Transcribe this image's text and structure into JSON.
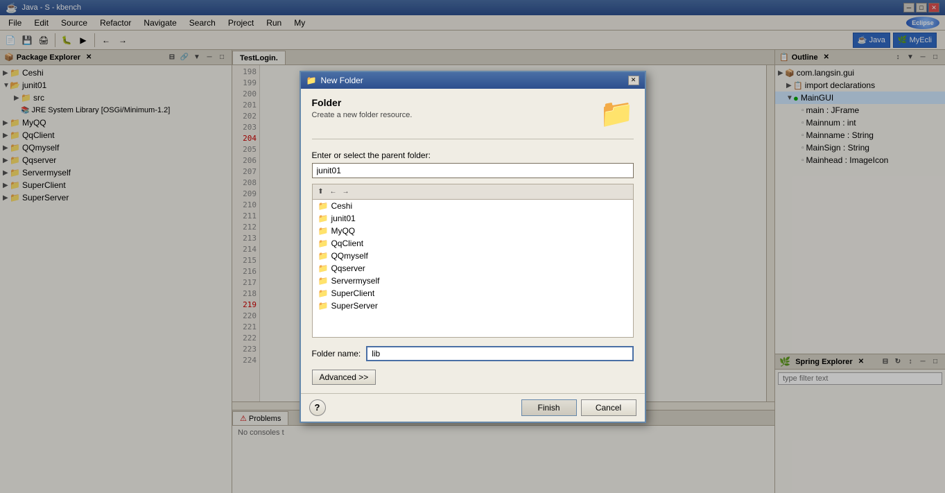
{
  "window": {
    "title": "Java - S",
    "title_full": "Java - S - kbench"
  },
  "dialog": {
    "title": "New Folder",
    "section_title": "Folder",
    "section_desc": "Create a new folder resource.",
    "parent_label": "Enter or select the parent folder:",
    "parent_value": "junit01",
    "folder_name_label": "Folder name:",
    "folder_name_value": "lib",
    "advanced_label": "Advanced >>",
    "finish_label": "Finish",
    "cancel_label": "Cancel",
    "help_label": "?",
    "tree_items": [
      {
        "label": "Ceshi",
        "icon": "📁"
      },
      {
        "label": "junit01",
        "icon": "📁"
      },
      {
        "label": "MyQQ",
        "icon": "📁"
      },
      {
        "label": "QqClient",
        "icon": "📁"
      },
      {
        "label": "QQmyself",
        "icon": "📁"
      },
      {
        "label": "Qqserver",
        "icon": "📁"
      },
      {
        "label": "Servermyself",
        "icon": "📁"
      },
      {
        "label": "SuperClient",
        "icon": "📁"
      },
      {
        "label": "SuperServer",
        "icon": "📁"
      }
    ]
  },
  "package_explorer": {
    "title": "Package Explorer",
    "items": [
      {
        "label": "Ceshi",
        "level": 0,
        "icon": "📁",
        "expanded": false
      },
      {
        "label": "junit01",
        "level": 0,
        "icon": "📂",
        "expanded": true
      },
      {
        "label": "src",
        "level": 1,
        "icon": "📁",
        "expanded": false
      },
      {
        "label": "JRE System Library [OSGi/Minimum-1.2]",
        "level": 1,
        "icon": "📚",
        "expanded": false
      },
      {
        "label": "MyQQ",
        "level": 0,
        "icon": "📁",
        "expanded": false
      },
      {
        "label": "QqClient",
        "level": 0,
        "icon": "📁",
        "expanded": false
      },
      {
        "label": "QQmyself",
        "level": 0,
        "icon": "📁",
        "expanded": false
      },
      {
        "label": "Qqserver",
        "level": 0,
        "icon": "📁",
        "expanded": false
      },
      {
        "label": "Servermyself",
        "level": 0,
        "icon": "📁",
        "expanded": false
      },
      {
        "label": "SuperClient",
        "level": 0,
        "icon": "📁",
        "expanded": false
      },
      {
        "label": "SuperServer",
        "level": 0,
        "icon": "📁",
        "expanded": false
      }
    ]
  },
  "editor": {
    "tab_label": "TestLogin.",
    "lines": [
      {
        "num": "198",
        "code": ""
      },
      {
        "num": "199",
        "code": ""
      },
      {
        "num": "200",
        "code": ""
      },
      {
        "num": "201",
        "code": ""
      },
      {
        "num": "202",
        "code": ""
      },
      {
        "num": "203",
        "code": ""
      },
      {
        "num": "204",
        "code": "",
        "marker": true
      },
      {
        "num": "205",
        "code": ""
      },
      {
        "num": "206",
        "code": ""
      },
      {
        "num": "207",
        "code": ""
      },
      {
        "num": "208",
        "code": ""
      },
      {
        "num": "209",
        "code": ""
      },
      {
        "num": "210",
        "code": ""
      },
      {
        "num": "211",
        "code": ""
      },
      {
        "num": "212",
        "code": ""
      },
      {
        "num": "213",
        "code": ""
      },
      {
        "num": "214",
        "code": ""
      },
      {
        "num": "215",
        "code": ""
      },
      {
        "num": "216",
        "code": ""
      },
      {
        "num": "217",
        "code": ""
      },
      {
        "num": "218",
        "code": ""
      },
      {
        "num": "219",
        "code": "",
        "marker": true
      },
      {
        "num": "220",
        "code": ""
      },
      {
        "num": "221",
        "code": ""
      },
      {
        "num": "222",
        "code": ""
      },
      {
        "num": "223",
        "code": ""
      },
      {
        "num": "224",
        "code": ""
      }
    ]
  },
  "outline": {
    "title": "Outline",
    "items": [
      {
        "label": "com.langsin.gui",
        "level": 0,
        "icon": "📦"
      },
      {
        "label": "import declarations",
        "level": 1,
        "icon": "📋"
      },
      {
        "label": "MainGUI",
        "level": 1,
        "icon": "🔷",
        "expanded": true
      },
      {
        "label": "main : JFrame",
        "level": 2,
        "icon": "▫"
      },
      {
        "label": "Mainnum : int",
        "level": 2,
        "icon": "▫"
      },
      {
        "label": "Mainname : String",
        "level": 2,
        "icon": "▫"
      },
      {
        "label": "MainSign : String",
        "level": 2,
        "icon": "▫"
      },
      {
        "label": "Mainhead : ImageIcon",
        "level": 2,
        "icon": "▫"
      }
    ]
  },
  "spring_explorer": {
    "title": "Spring Explorer",
    "filter_placeholder": "type filter text"
  },
  "bottom": {
    "tab_label": "Problems",
    "console_text": "No consoles t"
  },
  "menubar": {
    "items": [
      "File",
      "Edit",
      "Source",
      "Refactor",
      "Navigate",
      "Search",
      "Project",
      "Run",
      "My"
    ]
  }
}
